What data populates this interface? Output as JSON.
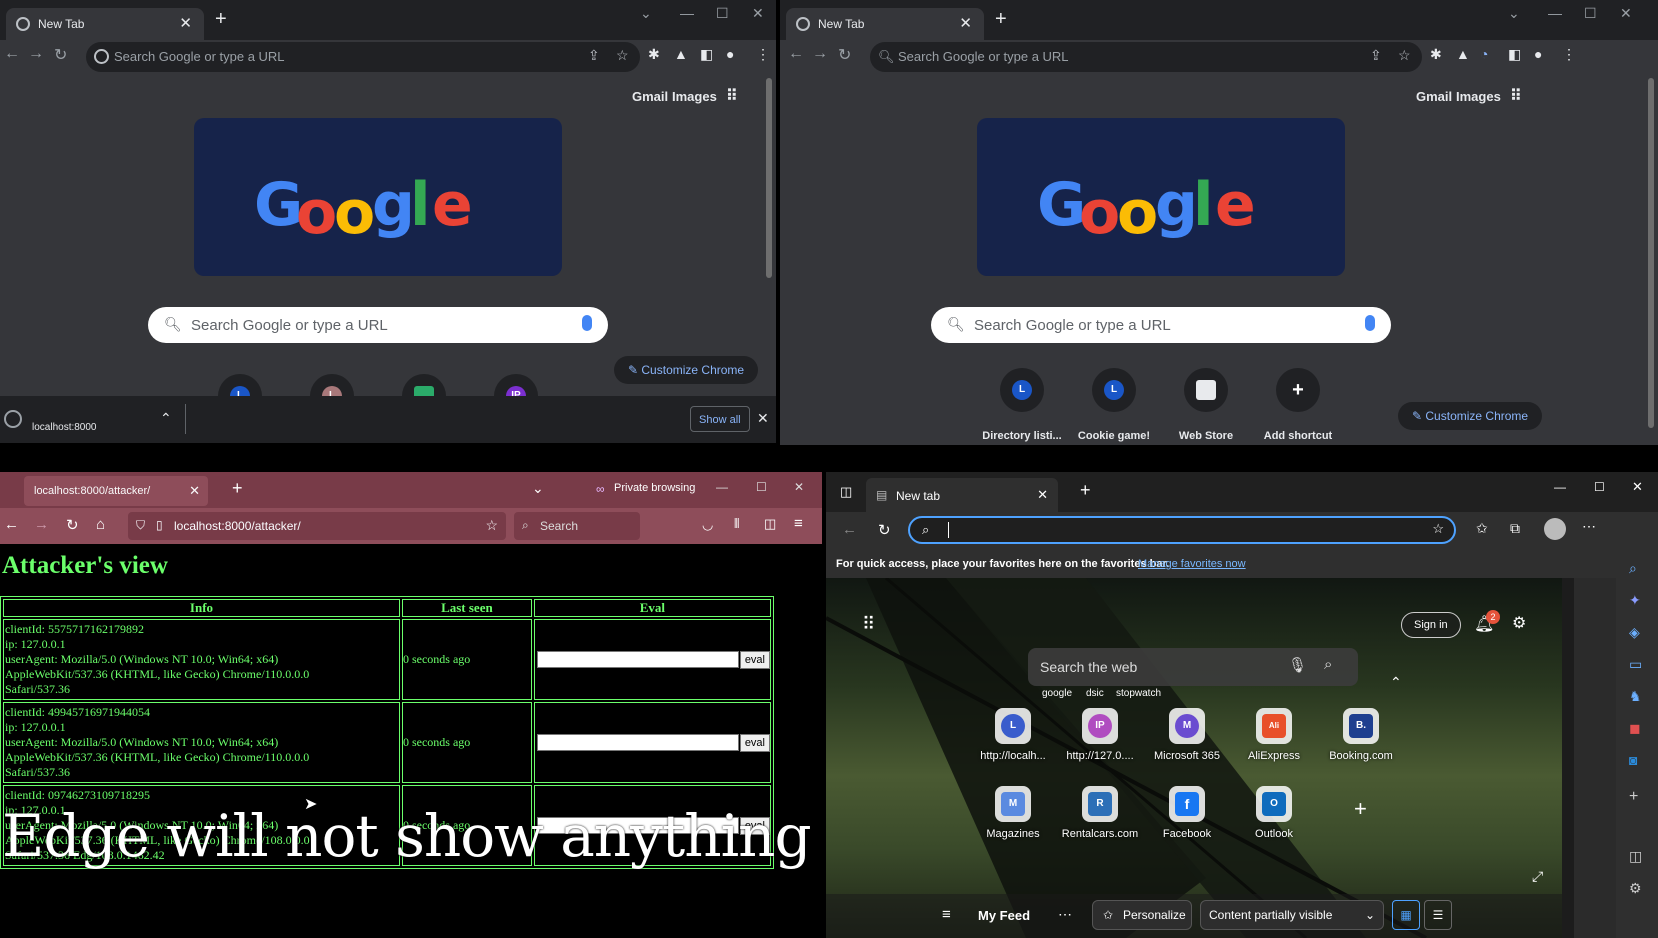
{
  "chrome_left": {
    "tab_title": "New Tab",
    "omnibox_placeholder": "Search Google or type a URL",
    "gmail": "Gmail",
    "images": "Images",
    "search_placeholder": "Search Google or type a URL",
    "shortcut_badges": [
      "L",
      "L",
      "",
      "IP"
    ],
    "customize": "Customize Chrome",
    "download_name": "localhost:8000",
    "show_all": "Show all"
  },
  "chrome_right": {
    "tab_title": "New Tab",
    "omnibox_placeholder": "Search Google or type a URL",
    "gmail": "Gmail",
    "images": "Images",
    "search_placeholder": "Search Google or type a URL",
    "shortcuts": [
      {
        "badge": "L",
        "label": "Directory listi..."
      },
      {
        "badge": "L",
        "label": "Cookie game!"
      },
      {
        "badge": "",
        "label": "Web Store"
      },
      {
        "badge": "+",
        "label": "Add shortcut"
      }
    ],
    "customize": "Customize Chrome"
  },
  "firefox": {
    "tab_title": "localhost:8000/attacker/",
    "private_label": "Private browsing",
    "url": "localhost:8000/attacker/",
    "search_placeholder": "Search",
    "heading": "Attacker's view",
    "columns": [
      "Info",
      "Last seen",
      "Eval"
    ],
    "eval_button": "eval",
    "rows": [
      {
        "client": "clientId: 55757171621798​92",
        "ip": "ip: 127.0.0.1",
        "ua1": "userAgent: Mozilla/5.0 (Windows NT 10.0; Win64; x64)",
        "ua2": "AppleWebKit/537.36 (KHTML, like Gecko) Chrome/110.0.0.0",
        "ua3": "Safari/537.36",
        "last_seen": "0 seconds ago"
      },
      {
        "client": "clientId: 49945716971944054",
        "ip": "ip: 127.0.0.1",
        "ua1": "userAgent: Mozilla/5.0 (Windows NT 10.0; Win64; x64)",
        "ua2": "AppleWebKit/537.36 (KHTML, like Gecko) Chrome/110.0.0.0",
        "ua3": "Safari/537.36",
        "last_seen": "0 seconds ago"
      },
      {
        "client": "clientId: 09746273109718295",
        "ip": "ip: 127.0.0.1",
        "ua1": "userAgent: Mozilla/5.0 (Windows NT 10.0; Win64; x64)",
        "ua2": "AppleWebKit/537.36 (KHTML, like Gecko) Chrome/108.0.0.0",
        "ua3": "Safari/537.36 Edg/108.0.1462.42",
        "last_seen": "0 seconds ago"
      }
    ]
  },
  "overlay_caption": "Edge will not show anything",
  "edge": {
    "tab_title": "New tab",
    "fav_bar_text": "For quick access, place your favorites here on the favorites bar.",
    "fav_bar_link": "Manage favorites now",
    "sign_in": "Sign in",
    "notif_count": "2",
    "search_placeholder": "Search the web",
    "suggestions": [
      "google",
      "dsic",
      "stopwatch"
    ],
    "quicklinks_row1": [
      {
        "badge": "L",
        "label": "http://localh...",
        "color": "#3a5ccc"
      },
      {
        "badge": "IP",
        "label": "http://127.0....",
        "color": "#b04cc0"
      },
      {
        "badge": "M",
        "label": "Microsoft 365",
        "color": "#6a4cd0"
      },
      {
        "badge": "Ali",
        "label": "AliExpress",
        "color": "#e8502a"
      },
      {
        "badge": "B.",
        "label": "Booking.com",
        "color": "#1e3f8f"
      }
    ],
    "quicklinks_row2": [
      {
        "badge": "M",
        "label": "Magazines",
        "color": "#5a8ae0"
      },
      {
        "badge": "R",
        "label": "Rentalcars.com",
        "color": "#2c6fb7"
      },
      {
        "badge": "f",
        "label": "Facebook",
        "color": "#1877f2"
      },
      {
        "badge": "O",
        "label": "Outlook",
        "color": "#0f6cbd"
      }
    ],
    "my_feed": "My Feed",
    "personalize": "Personalize",
    "content_visibility": "Content partially visible"
  }
}
